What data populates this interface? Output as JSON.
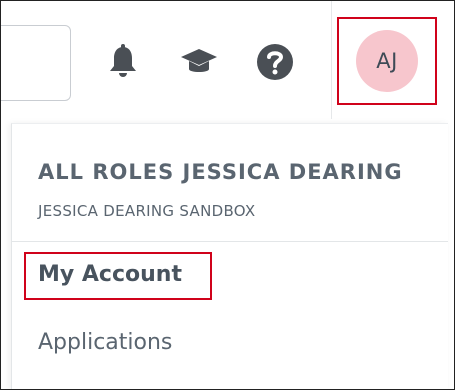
{
  "header": {
    "avatar_initials": "AJ",
    "icons": [
      "bell-icon",
      "graduation-cap-icon",
      "help-icon"
    ]
  },
  "account_menu": {
    "user_name": "ALL ROLES JESSICA DEARING",
    "environment": "JESSICA DEARING SANDBOX",
    "items": [
      {
        "label": "My Account"
      },
      {
        "label": "Applications"
      }
    ]
  },
  "colors": {
    "avatar_bg": "#f7c6cd",
    "text": "#5a6570",
    "highlight_border": "#d0021b",
    "icon": "#4a4f55"
  }
}
